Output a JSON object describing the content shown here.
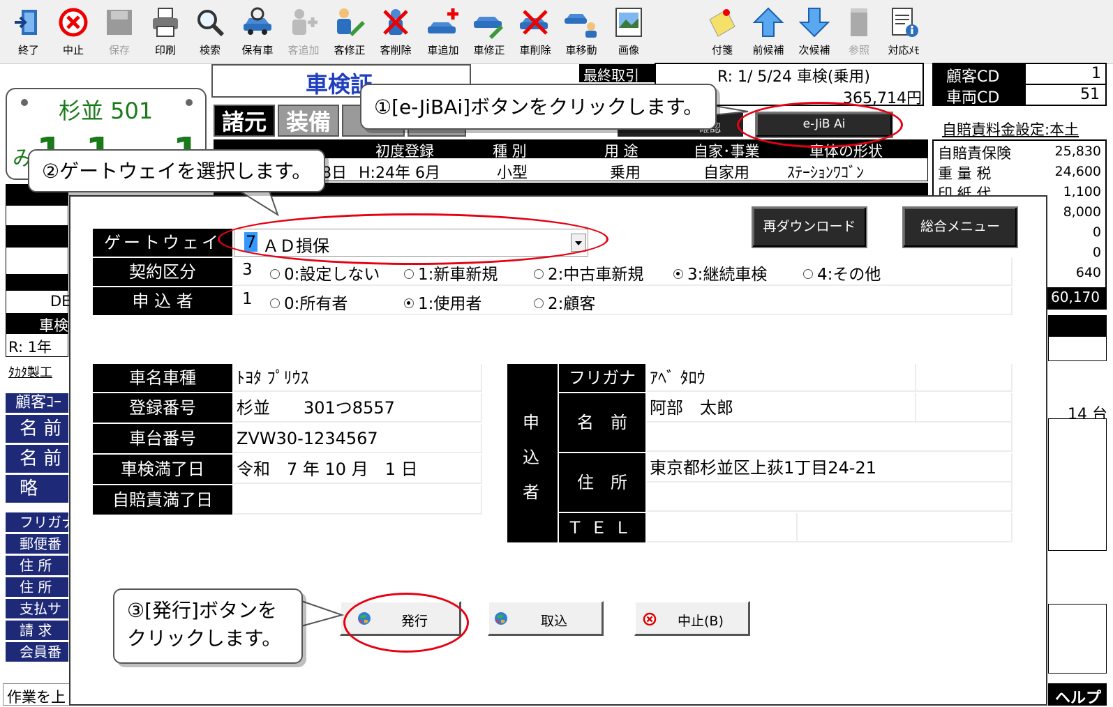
{
  "toolbar": {
    "items": [
      {
        "label": "終了",
        "icon": "exit-door-icon",
        "enabled": true
      },
      {
        "label": "中止",
        "icon": "stop-icon",
        "enabled": true
      },
      {
        "label": "保存",
        "icon": "save-icon",
        "enabled": false
      },
      {
        "label": "印刷",
        "icon": "printer-icon",
        "enabled": true
      },
      {
        "label": "検索",
        "icon": "magnifier-icon",
        "enabled": true
      },
      {
        "label": "保有車",
        "icon": "owned-car-icon",
        "enabled": true
      },
      {
        "label": "客追加",
        "icon": "add-customer-icon",
        "enabled": false
      },
      {
        "label": "客修正",
        "icon": "edit-customer-icon",
        "enabled": true
      },
      {
        "label": "客削除",
        "icon": "delete-customer-icon",
        "enabled": true
      },
      {
        "label": "車追加",
        "icon": "add-car-icon",
        "enabled": true
      },
      {
        "label": "車修正",
        "icon": "edit-car-icon",
        "enabled": true
      },
      {
        "label": "車削除",
        "icon": "delete-car-icon",
        "enabled": true
      },
      {
        "label": "車移動",
        "icon": "move-car-icon",
        "enabled": true
      },
      {
        "label": "画像",
        "icon": "image-icon",
        "enabled": true
      },
      {
        "label": "付箋",
        "icon": "sticky-note-icon",
        "enabled": true
      },
      {
        "label": "前候補",
        "icon": "arrow-up-icon",
        "enabled": true
      },
      {
        "label": "次候補",
        "icon": "arrow-down-icon",
        "enabled": true
      },
      {
        "label": "参照",
        "icon": "reference-icon",
        "enabled": false
      },
      {
        "label": "対応ﾒﾓ",
        "icon": "memo-info-icon",
        "enabled": true
      }
    ]
  },
  "main": {
    "shaken_title": "車検証",
    "last_deal_label": "最終取引",
    "last_deal_text": "R: 1/ 5/24 車検(乗用)",
    "last_deal_amount": "365,714円",
    "customer_cd_label": "顧客CD",
    "customer_cd_value": "1",
    "vehicle_cd_label": "車両CD",
    "vehicle_cd_value": "51",
    "plate_top": "杉並 501",
    "plate_kana": "み",
    "plate_number": "1 1 - 1 1",
    "tabs": [
      "諸元",
      "装備"
    ],
    "confirm_partial": "確認",
    "ejibai_label": "e-JiB Ai",
    "jibai_setting_link": "自賠責料金設定:本土",
    "first_reg_header": "初度登録",
    "type_header": "種 別",
    "use_header": "用 途",
    "private_header": "自家･事業",
    "shape_header": "車体の形状",
    "reg_date_partial": "月 8日",
    "first_reg_value": "H:24年 6月",
    "type_value": "小型",
    "use_value": "乗用",
    "private_value": "自家用",
    "shape_value": "ｽﾃｰｼｮﾝﾜｺﾞﾝ",
    "fees": [
      {
        "label": "自賠責保険",
        "value": "25,830"
      },
      {
        "label": "重 量 税",
        "value": "24,600"
      },
      {
        "label": "印 紙 代",
        "value": "1,100"
      },
      {
        "label": "",
        "value": "8,000"
      },
      {
        "label": "",
        "value": "0"
      },
      {
        "label": "",
        "value": "0"
      },
      {
        "label": "",
        "value": "640"
      }
    ],
    "fee_total": "60,170",
    "left_fragments": {
      "de": "DE",
      "shaken": "車検",
      "r1": "R: 1年",
      "maker": "ﾀｶﾀ製工",
      "customer_code": "顧客ｺｰ",
      "name1": "名 前",
      "name2": "名 前",
      "abbr": "略",
      "furigana": "フリガナ",
      "zip": "郵便番",
      "address1": "住 所",
      "address2": "住 所",
      "payment": "支払サ",
      "billing": "請 求",
      "member": "会員番"
    },
    "car_count": "14 台",
    "status_text": "作業を上",
    "help_label": "ヘルプ"
  },
  "dialog": {
    "redownload_label": "再ダウンロード",
    "main_menu_label": "総合メニュー",
    "gateway": {
      "label": "ゲートウェイ",
      "code": "7",
      "value": "ＡＤ損保"
    },
    "contract": {
      "label": "契約区分",
      "code": "3",
      "options": [
        "0:設定しない",
        "1:新車新規",
        "2:中古車新規",
        "3:継続車検",
        "4:その他"
      ],
      "selected": 3
    },
    "applicant": {
      "label": "申 込 者",
      "code": "1",
      "options": [
        "0:所有者",
        "1:使用者",
        "2:顧客"
      ],
      "selected": 1
    },
    "car": {
      "name_label": "車名車種",
      "name_value": "ﾄﾖﾀ ﾌﾟﾘｳｽ",
      "reg_label": "登録番号",
      "reg_value": "杉並　　301つ8557",
      "chassis_label": "車台番号",
      "chassis_value": "ZVW30-1234567",
      "expiry_label": "車検満了日",
      "expiry_value": "令和　7 年 10 月　1 日",
      "jibai_label": "自賠責満了日",
      "jibai_value": ""
    },
    "applicant_block": {
      "side_label": [
        "申",
        "込",
        "者"
      ],
      "furigana_label": "フリガナ",
      "furigana_value": "ｱﾍﾞ ﾀﾛｳ",
      "name_label": "名　前",
      "name_value": "阿部　太郎",
      "address_label": "住　所",
      "address_value": "東京都杉並区上荻1丁目24-21",
      "tel_label": "ＴＥＬ",
      "tel_value": ""
    },
    "buttons": {
      "issue": "発行",
      "import": "取込",
      "cancel": "中止(B)"
    }
  },
  "callouts": {
    "step1": "①[e-JiBAi]ボタンをクリックします。",
    "step2": "②ゲートウェイを選択します。",
    "step3_line1": "③[発行]ボタンを",
    "step3_line2": "クリックします。"
  },
  "colors": {
    "highlight": "#e60012",
    "title_blue": "#1f3fbf",
    "plate_green": "#1a7a1a",
    "left_navy": "#1e2a78"
  }
}
